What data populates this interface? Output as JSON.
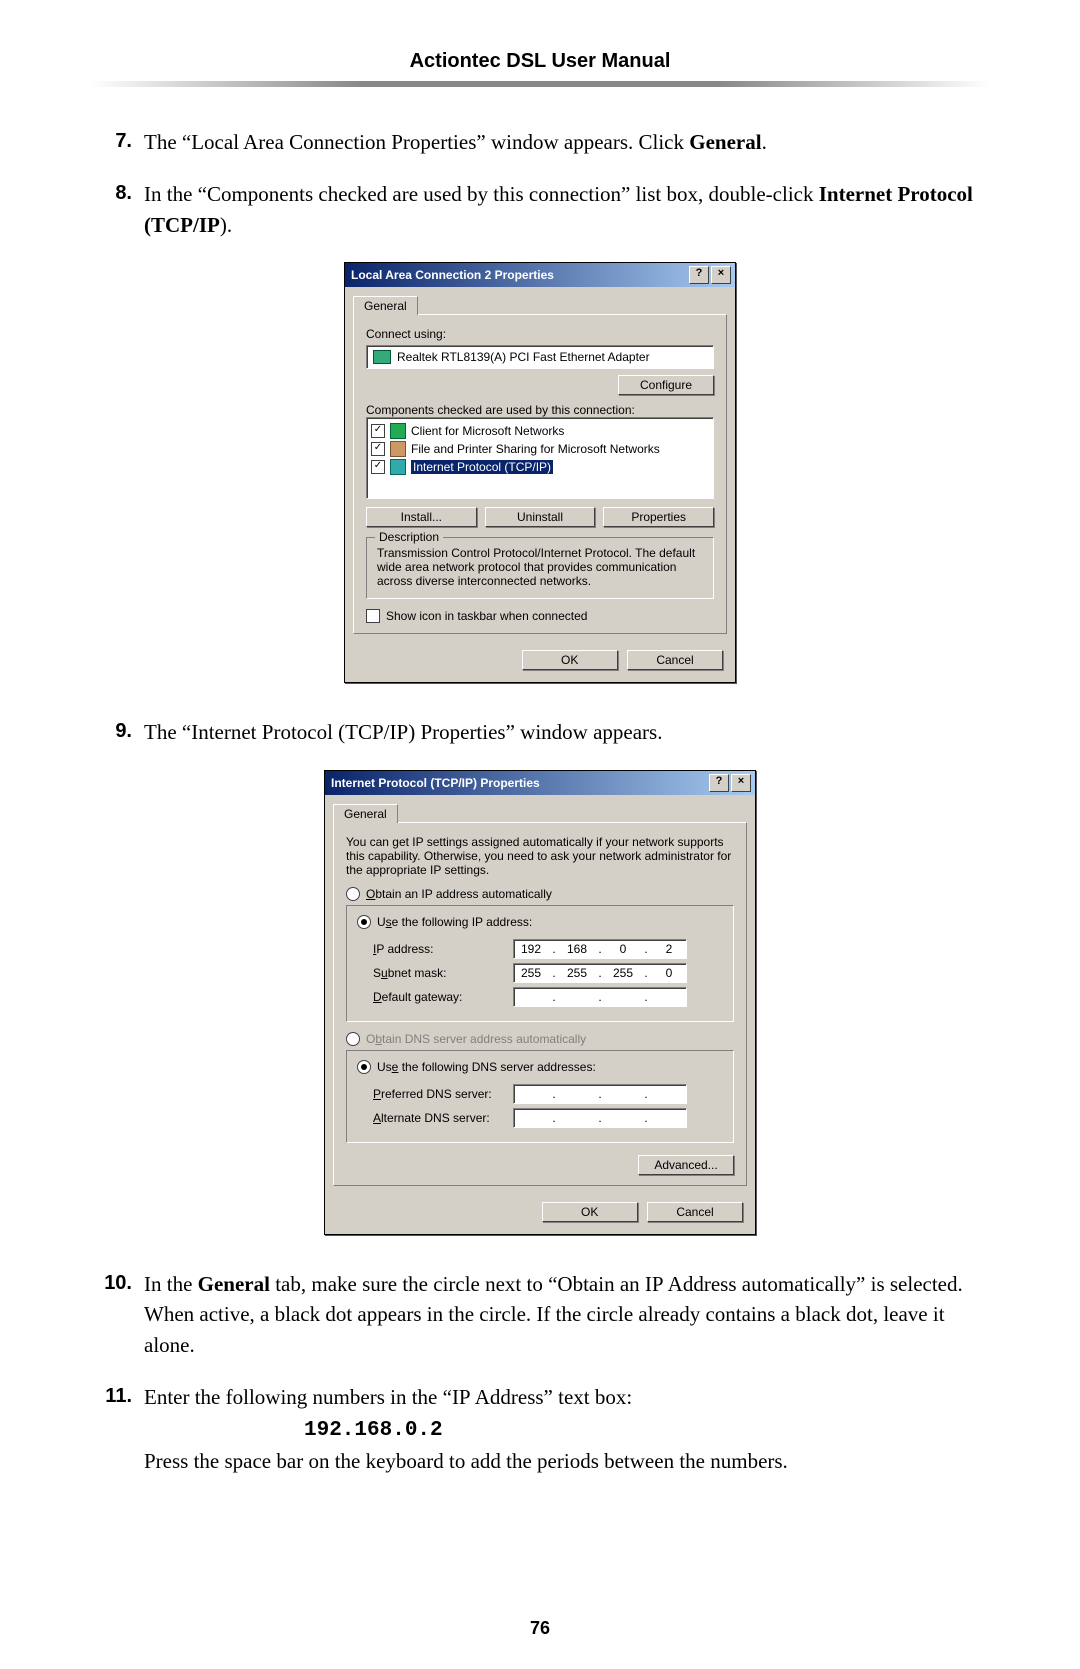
{
  "header": {
    "title": "Actiontec DSL User Manual"
  },
  "page_number": "76",
  "steps": {
    "s7": {
      "num": "7.",
      "text_a": "The “Local Area Connection Properties” window appears. Click ",
      "bold": "General",
      "text_b": "."
    },
    "s8": {
      "num": "8.",
      "text_a": "In the “Components checked are used by this connection” list box, double-click ",
      "bold": "Internet Protocol (",
      "smallcaps": "TCP/IP",
      "text_b": ")."
    },
    "s9": {
      "num": "9.",
      "text_a": "The “Internet Protocol (",
      "smallcaps": "TCP/IP",
      "text_b": ") Properties” window appears."
    },
    "s10": {
      "num": "10.",
      "text_a": "In the ",
      "bold": "General",
      "text_b": " tab, make sure the circle next to “Obtain an ",
      "smallcaps": "IP",
      "text_c": " Address automatically” is selected. When active, a black dot appears in the circle.  If the circle already contains a black dot, leave it alone."
    },
    "s11": {
      "num": "11.",
      "text_a": "Enter the following numbers in the “",
      "smallcaps": "IP",
      "text_b": " Address” text box:",
      "code": "192.168.0.2",
      "text_c": "Press the space bar on the keyboard to add the periods between the numbers."
    }
  },
  "dlg1": {
    "title": "Local Area Connection 2 Properties",
    "help_btn": "?",
    "close_btn": "×",
    "tab": "General",
    "connect_label": "Connect using:",
    "adapter": "Realtek RTL8139(A) PCI Fast Ethernet Adapter",
    "configure": "Configure",
    "components_label": "Components checked are used by this connection:",
    "items": [
      "Client for Microsoft Networks",
      "File and Printer Sharing for Microsoft Networks",
      "Internet Protocol (TCP/IP)"
    ],
    "install": "Install...",
    "uninstall": "Uninstall",
    "properties": "Properties",
    "desc_legend": "Description",
    "desc_text": "Transmission Control Protocol/Internet Protocol. The default wide area network protocol that provides communication across diverse interconnected networks.",
    "show_icon": "Show icon in taskbar when connected",
    "ok": "OK",
    "cancel": "Cancel"
  },
  "dlg2": {
    "title": "Internet Protocol (TCP/IP) Properties",
    "help_btn": "?",
    "close_btn": "×",
    "tab": "General",
    "intro": "You can get IP settings assigned automatically if your network supports this capability. Otherwise, you need to ask your network administrator for the appropriate IP settings.",
    "opt_auto_ip": "Obtain an IP address automatically",
    "opt_use_ip": "Use the following IP address:",
    "ip_label": "IP address:",
    "ip_value": [
      "192",
      "168",
      "0",
      "2"
    ],
    "subnet_label": "Subnet mask:",
    "subnet_value": [
      "255",
      "255",
      "255",
      "0"
    ],
    "gateway_label": "Default gateway:",
    "opt_auto_dns": "Obtain DNS server address automatically",
    "opt_use_dns": "Use the following DNS server addresses:",
    "pref_dns": "Preferred DNS server:",
    "alt_dns": "Alternate DNS server:",
    "advanced": "Advanced...",
    "ok": "OK",
    "cancel": "Cancel"
  }
}
